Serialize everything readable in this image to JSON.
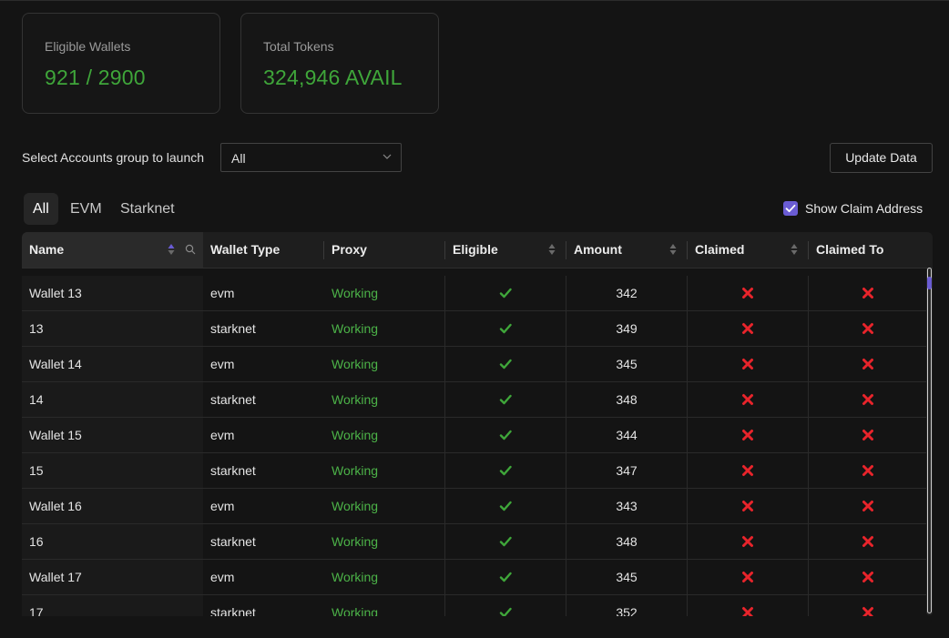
{
  "stats": {
    "eligible_label": "Eligible Wallets",
    "eligible_value": "921 / 2900",
    "tokens_label": "Total Tokens",
    "tokens_value": "324,946 AVAIL",
    "value_color": "#3fa63a"
  },
  "controls": {
    "group_label": "Select Accounts group to launch",
    "group_selected": "All",
    "update_button": "Update Data"
  },
  "tabs": [
    {
      "label": "All",
      "active": true
    },
    {
      "label": "EVM",
      "active": false
    },
    {
      "label": "Starknet",
      "active": false
    }
  ],
  "show_claim": {
    "label": "Show Claim Address",
    "checked": true
  },
  "table": {
    "columns": [
      "Name",
      "Wallet Type",
      "Proxy",
      "Eligible",
      "Amount",
      "Claimed",
      "Claimed To"
    ],
    "rows": [
      {
        "name": "Wallet 13",
        "type": "evm",
        "proxy": "Working",
        "eligible": true,
        "amount": "342",
        "claimed": false,
        "claimed_to": false
      },
      {
        "name": "13",
        "type": "starknet",
        "proxy": "Working",
        "eligible": true,
        "amount": "349",
        "claimed": false,
        "claimed_to": false
      },
      {
        "name": "Wallet 14",
        "type": "evm",
        "proxy": "Working",
        "eligible": true,
        "amount": "345",
        "claimed": false,
        "claimed_to": false
      },
      {
        "name": "14",
        "type": "starknet",
        "proxy": "Working",
        "eligible": true,
        "amount": "348",
        "claimed": false,
        "claimed_to": false
      },
      {
        "name": "Wallet 15",
        "type": "evm",
        "proxy": "Working",
        "eligible": true,
        "amount": "344",
        "claimed": false,
        "claimed_to": false
      },
      {
        "name": "15",
        "type": "starknet",
        "proxy": "Working",
        "eligible": true,
        "amount": "347",
        "claimed": false,
        "claimed_to": false
      },
      {
        "name": "Wallet 16",
        "type": "evm",
        "proxy": "Working",
        "eligible": true,
        "amount": "343",
        "claimed": false,
        "claimed_to": false
      },
      {
        "name": "16",
        "type": "starknet",
        "proxy": "Working",
        "eligible": true,
        "amount": "348",
        "claimed": false,
        "claimed_to": false
      },
      {
        "name": "Wallet 17",
        "type": "evm",
        "proxy": "Working",
        "eligible": true,
        "amount": "345",
        "claimed": false,
        "claimed_to": false
      },
      {
        "name": "17",
        "type": "starknet",
        "proxy": "Working",
        "eligible": true,
        "amount": "352",
        "claimed": false,
        "claimed_to": false
      }
    ],
    "icons": {
      "yes": "check-icon",
      "no": "cross-icon"
    },
    "colors": {
      "yes": "#3fa63a",
      "no": "#e8242b",
      "proxy_working": "#4cb348",
      "accent": "#6a5cd4"
    }
  }
}
